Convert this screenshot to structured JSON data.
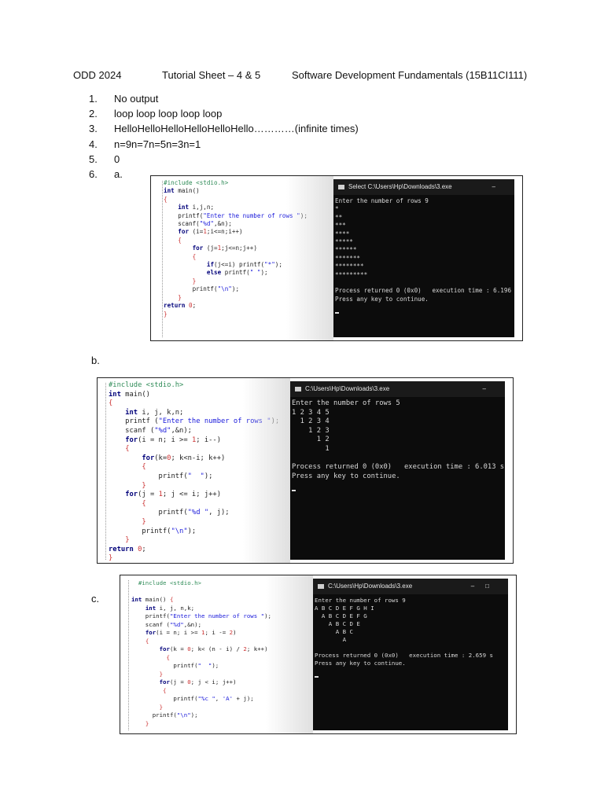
{
  "header": {
    "term": "ODD 2024",
    "sheet": "Tutorial Sheet – 4 & 5",
    "course": "Software Development Fundamentals (15B11CI111)"
  },
  "answers": [
    {
      "num": "1.",
      "text": "No output"
    },
    {
      "num": "2.",
      "text": "loop loop loop loop loop"
    },
    {
      "num": "3.",
      "text": "HelloHelloHelloHelloHelloHello…………(infinite times)"
    },
    {
      "num": "4.",
      "text": "n=9n=7n=5n=3n=1"
    },
    {
      "num": "5.",
      "text": "0"
    },
    {
      "num": "6.",
      "text": "a."
    }
  ],
  "sub_labels": {
    "b": "b.",
    "c": "c."
  },
  "screenshots": {
    "a": {
      "console_title": "Select C:\\Users\\Hp\\Downloads\\3.exe",
      "console_output": "Enter the number of rows 9\n*\n**\n***\n****\n*****\n******\n*******\n********\n*********\n\nProcess returned 0 (0x0)   execution time : 6.196 s\nPress any key to continue."
    },
    "b": {
      "console_title": "C:\\Users\\Hp\\Downloads\\3.exe",
      "console_output": "Enter the number of rows 5\n1 2 3 4 5\n  1 2 3 4\n    1 2 3\n      1 2\n        1\n\nProcess returned 0 (0x0)   execution time : 6.013 s\nPress any key to continue."
    },
    "c": {
      "console_title": "C:\\Users\\Hp\\Downloads\\3.exe",
      "console_output": "Enter the number of rows 9\nA B C D E F G H I\n  A B C D E F G\n    A B C D E\n      A B C\n        A\n\nProcess returned 0 (0x0)   execution time : 2.659 s\nPress any key to continue."
    }
  }
}
